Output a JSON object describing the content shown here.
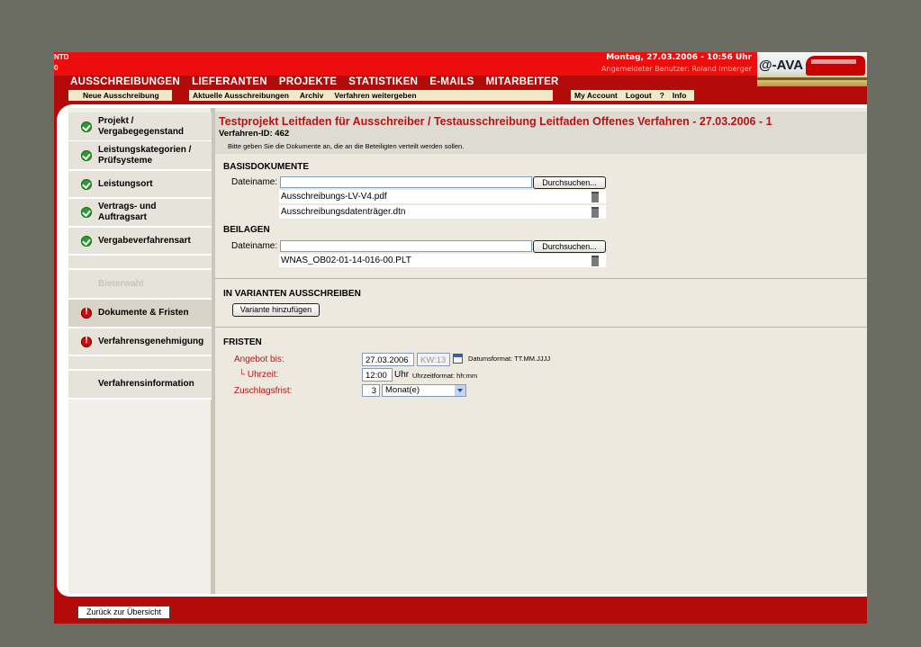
{
  "header": {
    "corner_lines": [
      "NTD",
      "0"
    ],
    "datetime": "Montag, 27.03.2006 - 10:56 Uhr",
    "user": "Angemeldeter Benutzer: Roland Imberger",
    "logo_text": "@-AVA"
  },
  "mainnav": [
    "AUSSCHREIBUNGEN",
    "LIEFERANTEN",
    "PROJEKTE",
    "STATISTIKEN",
    "E-MAILS",
    "MITARBEITER"
  ],
  "subnav": {
    "new": "Neue Ausschreibung",
    "current": "Aktuelle Ausschreibungen",
    "archive": "Archiv",
    "pass_on": "Verfahren weitergeben",
    "account": "My Account",
    "logout": "Logout",
    "help": "?",
    "info": "Info"
  },
  "sidebar": {
    "items": [
      {
        "label1": "Projekt /",
        "label2": "Vergabegegenstand",
        "status": "ok"
      },
      {
        "label1": "Leistungskategorien /",
        "label2": "Prüfsysteme",
        "status": "ok"
      },
      {
        "label1": "Leistungsort",
        "label2": "",
        "status": "ok"
      },
      {
        "label1": "Vertrags- und",
        "label2": "Auftragsart",
        "status": "ok"
      },
      {
        "label1": "Vergabeverfahrensart",
        "label2": "",
        "status": "ok"
      },
      {
        "label1": "Bieterwahl",
        "label2": "",
        "status": "disabled"
      },
      {
        "label1": "Dokumente & Fristen",
        "label2": "",
        "status": "error"
      },
      {
        "label1": "Verfahrensgenehmigung",
        "label2": "",
        "status": "error"
      },
      {
        "label1": "Verfahrensinformation",
        "label2": "",
        "status": "none"
      }
    ]
  },
  "main": {
    "title": "Testprojekt Leitfaden für Ausschreiber / Testausschreibung Leitfaden Offenes Verfahren - 27.03.2006 - 1",
    "procedure_id": "Verfahren-ID: 462",
    "hint": "Bitte geben Sie die Dokumente an, die an die Beteiligten verteilt werden sollen.",
    "basis": {
      "heading": "BASISDOKUMENTE",
      "file_label": "Dateiname:",
      "browse": "Durchsuchen...",
      "files": [
        "Ausschreibungs-LV-V4.pdf",
        "Ausschreibungsdatenträger.dtn"
      ]
    },
    "attachments": {
      "heading": "BEILAGEN",
      "file_label": "Dateiname:",
      "browse": "Durchsuchen...",
      "files": [
        "WNAS_OB02-01-14-016-00.PLT"
      ]
    },
    "variants": {
      "heading": "IN VARIANTEN AUSSCHREIBEN",
      "add_button": "Variante hinzufügen"
    },
    "deadlines": {
      "heading": "FRISTEN",
      "offer_label": "Angebot bis:",
      "offer_date": "27.03.2006",
      "week": "KW:13",
      "date_format": "Datumsformat: TT.MM.JJJJ",
      "time_label": "└ Uhrzeit:",
      "time": "12:00",
      "time_unit": "Uhr",
      "time_format": "Uhrzeitformat: hh:mm",
      "award_label": "Zuschlagsfrist:",
      "award_value": "3",
      "award_unit": "Monat(e)"
    }
  },
  "footer": {
    "back_button": "Zurück zur Übersicht"
  }
}
